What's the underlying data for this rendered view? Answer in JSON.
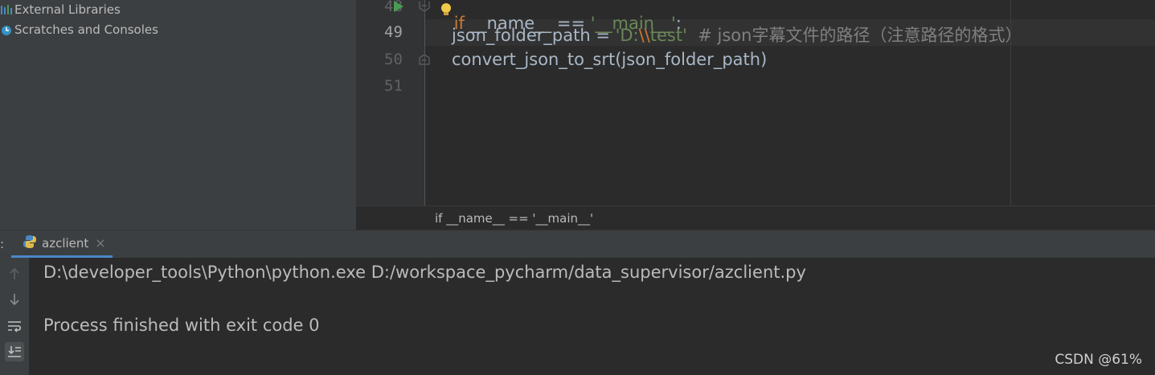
{
  "project": {
    "items": [
      {
        "label": "External Libraries",
        "icon": "libraries-icon"
      },
      {
        "label": "Scratches and Consoles",
        "icon": "scratches-icon"
      }
    ]
  },
  "editor": {
    "line_numbers": [
      "48",
      "49",
      "50",
      "51"
    ],
    "line48": {
      "kw": "if",
      "name": "__name__",
      "op": " == ",
      "str": "'__main__'",
      "colon": ":"
    },
    "line49": {
      "var": "json_folder_path",
      "eq": " = ",
      "q1": "'D:",
      "esc": "\\\\",
      "rest": "test'",
      "comment": "# json字幕文件的路径（注意路径的格式）"
    },
    "line50": {
      "call": "convert_json_to_srt(json_folder_path)"
    },
    "breadcrumb": "if __name__ == '__main__'"
  },
  "run": {
    "tab_label": "azclient",
    "tab_prefix": ":",
    "close_glyph": "×",
    "command": "D:\\developer_tools\\Python\\python.exe D:/workspace_pycharm/data_supervisor/azclient.py",
    "result": "Process finished with exit code 0"
  },
  "watermark": "CSDN @61%",
  "colors": {
    "keyword": "#cc7832",
    "string": "#6a8759",
    "comment": "#808080",
    "run_accent": "#4a88c7"
  }
}
